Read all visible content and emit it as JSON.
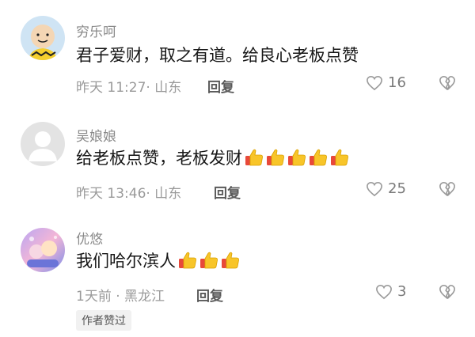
{
  "comments": [
    {
      "username": "穷乐呵",
      "text": "君子爱财，取之有道。给良心老板点赞",
      "time": "昨天 11:27· 山东",
      "reply_label": "回复",
      "likes": "16",
      "thumbs_count": 0,
      "avatar": "peanuts-character"
    },
    {
      "username": "吴娘娘",
      "text": "给老板点赞，老板发财",
      "time": "昨天 13:46· 山东",
      "reply_label": "回复",
      "likes": "25",
      "thumbs_count": 5,
      "avatar": "default-gray-person"
    },
    {
      "username": "优悠",
      "text": "我们哈尔滨人",
      "time": "1天前 · 黑龙江",
      "reply_label": "回复",
      "likes": "3",
      "thumbs_count": 3,
      "avatar": "colorful-illustration",
      "tag": "作者赞过"
    }
  ],
  "icons": {
    "like": "heart-outline-icon",
    "dislike": "broken-heart-icon",
    "thumbs": "thumbs-up-emoji"
  },
  "colors": {
    "thumb_yellow": "#f8c529",
    "thumb_cuff": "#e8493a",
    "icon_gray": "#9a9a9a"
  }
}
